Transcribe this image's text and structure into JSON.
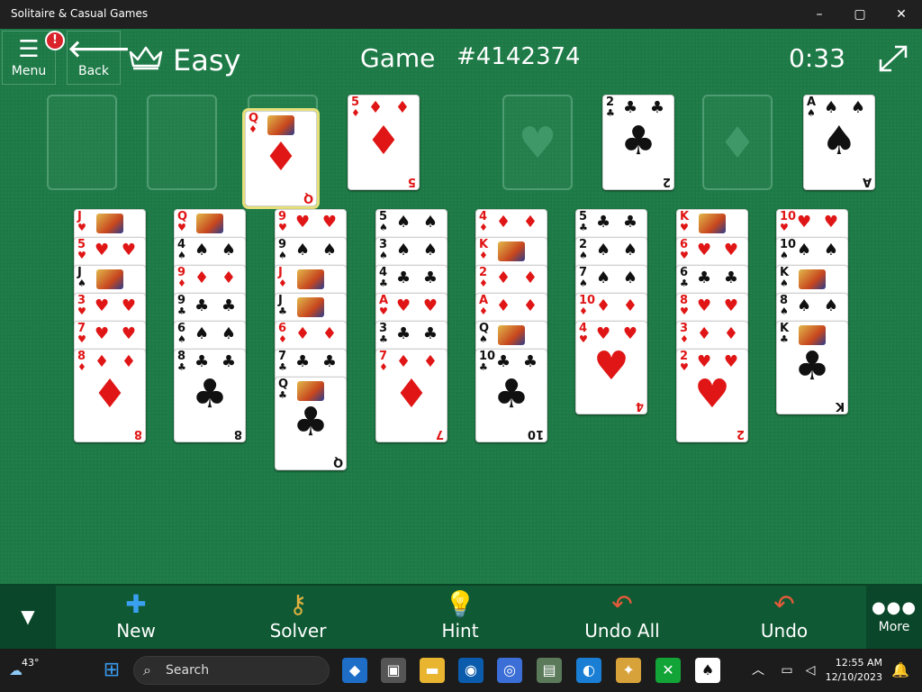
{
  "window": {
    "title": "Solitaire & Casual Games",
    "controls": {
      "minimize": "–",
      "maximize": "▢",
      "close": "✕"
    }
  },
  "header": {
    "menu_label": "Menu",
    "menu_badge": "!",
    "back_label": "Back",
    "difficulty": "Easy",
    "game_label": "Game",
    "game_number": "#4142374",
    "timer": "0:33"
  },
  "board": {
    "freecells": [
      {
        "state": "empty"
      },
      {
        "state": "empty"
      },
      {
        "rank": "Q",
        "suit": "♦",
        "color": "red",
        "selected": true
      },
      {
        "rank": "5",
        "suit": "♦",
        "color": "red"
      }
    ],
    "foundations": [
      {
        "state": "empty",
        "symbol": "♥"
      },
      {
        "rank": "2",
        "suit": "♣",
        "color": "black"
      },
      {
        "state": "empty",
        "symbol": "♦"
      },
      {
        "rank": "A",
        "suit": "♠",
        "color": "black"
      }
    ],
    "columns": [
      [
        {
          "rank": "J",
          "suit": "♥",
          "color": "red"
        },
        {
          "rank": "5",
          "suit": "♥",
          "color": "red"
        },
        {
          "rank": "J",
          "suit": "♠",
          "color": "black"
        },
        {
          "rank": "3",
          "suit": "♥",
          "color": "red"
        },
        {
          "rank": "7",
          "suit": "♥",
          "color": "red"
        },
        {
          "rank": "8",
          "suit": "♦",
          "color": "red"
        }
      ],
      [
        {
          "rank": "Q",
          "suit": "♥",
          "color": "red"
        },
        {
          "rank": "4",
          "suit": "♠",
          "color": "black"
        },
        {
          "rank": "9",
          "suit": "♦",
          "color": "red"
        },
        {
          "rank": "9",
          "suit": "♣",
          "color": "black"
        },
        {
          "rank": "6",
          "suit": "♠",
          "color": "black"
        },
        {
          "rank": "8",
          "suit": "♣",
          "color": "black"
        }
      ],
      [
        {
          "rank": "9",
          "suit": "♥",
          "color": "red"
        },
        {
          "rank": "9",
          "suit": "♠",
          "color": "black"
        },
        {
          "rank": "J",
          "suit": "♦",
          "color": "red"
        },
        {
          "rank": "J",
          "suit": "♣",
          "color": "black"
        },
        {
          "rank": "6",
          "suit": "♦",
          "color": "red"
        },
        {
          "rank": "7",
          "suit": "♣",
          "color": "black"
        },
        {
          "rank": "Q",
          "suit": "♣",
          "color": "black"
        }
      ],
      [
        {
          "rank": "5",
          "suit": "♠",
          "color": "black"
        },
        {
          "rank": "3",
          "suit": "♠",
          "color": "black"
        },
        {
          "rank": "4",
          "suit": "♣",
          "color": "black"
        },
        {
          "rank": "A",
          "suit": "♥",
          "color": "red"
        },
        {
          "rank": "3",
          "suit": "♣",
          "color": "black"
        },
        {
          "rank": "7",
          "suit": "♦",
          "color": "red"
        }
      ],
      [
        {
          "rank": "4",
          "suit": "♦",
          "color": "red"
        },
        {
          "rank": "K",
          "suit": "♦",
          "color": "red"
        },
        {
          "rank": "2",
          "suit": "♦",
          "color": "red"
        },
        {
          "rank": "A",
          "suit": "♦",
          "color": "red"
        },
        {
          "rank": "Q",
          "suit": "♠",
          "color": "black"
        },
        {
          "rank": "10",
          "suit": "♣",
          "color": "black"
        }
      ],
      [
        {
          "rank": "5",
          "suit": "♣",
          "color": "black"
        },
        {
          "rank": "2",
          "suit": "♠",
          "color": "black"
        },
        {
          "rank": "7",
          "suit": "♠",
          "color": "black"
        },
        {
          "rank": "10",
          "suit": "♦",
          "color": "red"
        },
        {
          "rank": "4",
          "suit": "♥",
          "color": "red"
        }
      ],
      [
        {
          "rank": "K",
          "suit": "♥",
          "color": "red"
        },
        {
          "rank": "6",
          "suit": "♥",
          "color": "red"
        },
        {
          "rank": "6",
          "suit": "♣",
          "color": "black"
        },
        {
          "rank": "8",
          "suit": "♥",
          "color": "red"
        },
        {
          "rank": "3",
          "suit": "♦",
          "color": "red"
        },
        {
          "rank": "2",
          "suit": "♥",
          "color": "red"
        }
      ],
      [
        {
          "rank": "10",
          "suit": "♥",
          "color": "red"
        },
        {
          "rank": "10",
          "suit": "♠",
          "color": "black"
        },
        {
          "rank": "K",
          "suit": "♠",
          "color": "black"
        },
        {
          "rank": "8",
          "suit": "♠",
          "color": "black"
        },
        {
          "rank": "K",
          "suit": "♣",
          "color": "black"
        }
      ]
    ]
  },
  "toolbar": {
    "new_label": "New",
    "solver_label": "Solver",
    "hint_label": "Hint",
    "undo_all_label": "Undo All",
    "undo_label": "Undo",
    "more_label": "More"
  },
  "taskbar": {
    "weather_temp": "43°",
    "search_label": "Search",
    "time": "12:55 AM",
    "date": "12/10/2023"
  },
  "colors": {
    "felt": "#1d7a46",
    "toolbar": "#0f5a34",
    "red_suit": "#e01515",
    "taskbar": "#1c1c1c"
  }
}
